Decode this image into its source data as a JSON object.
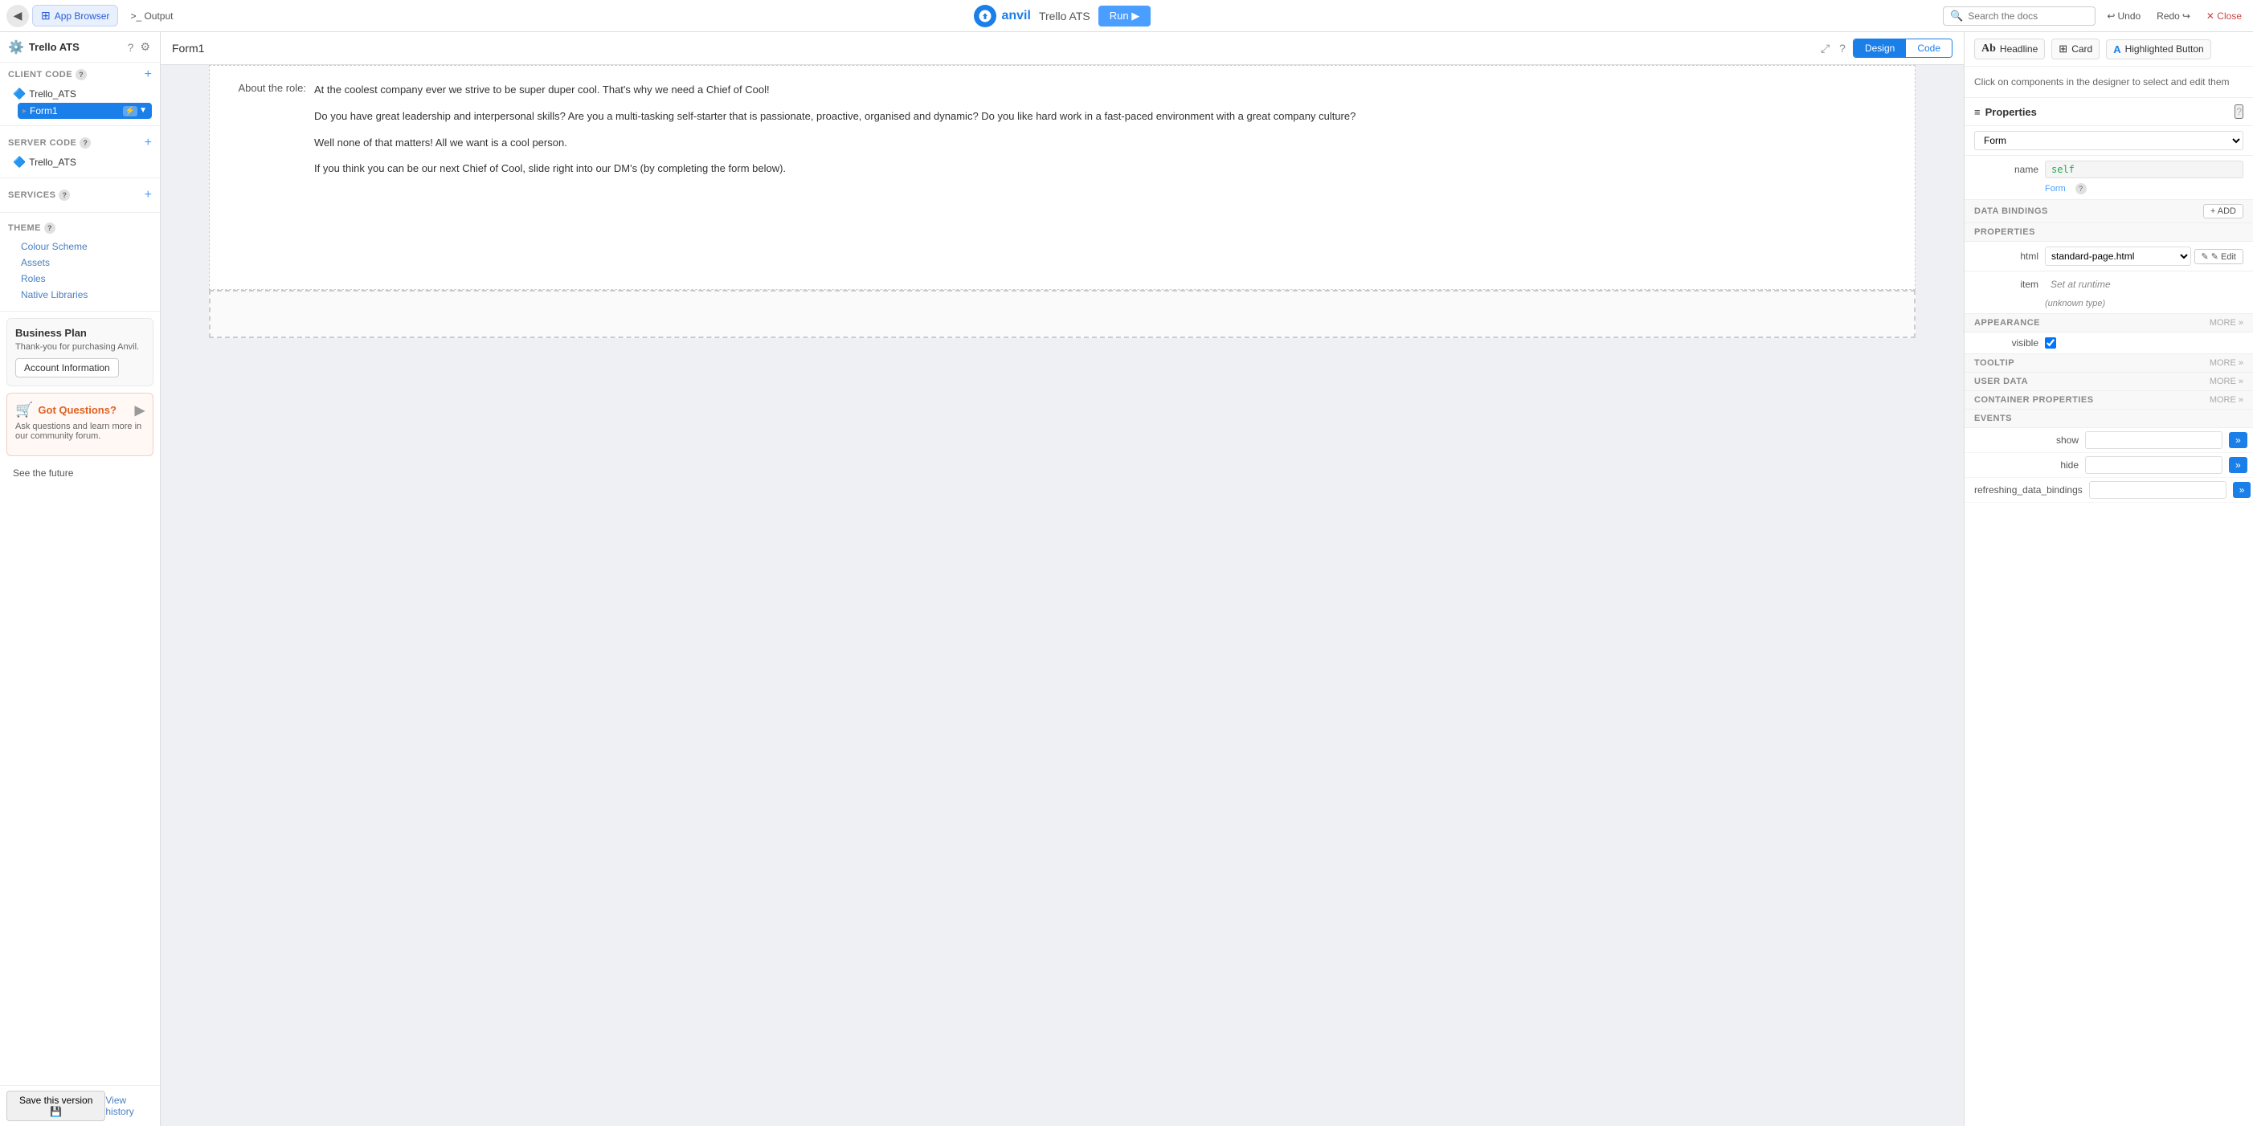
{
  "topbar": {
    "app_browser_label": "App Browser",
    "output_label": ">_ Output",
    "app_name": "Trello ATS",
    "run_label": "Run ▶",
    "search_placeholder": "Search the docs",
    "undo_label": "Undo",
    "redo_label": "Redo",
    "close_label": "✕ Close",
    "anvil_label": "anvil"
  },
  "sidebar": {
    "title": "Trello ATS",
    "client_code_label": "CLIENT CODE",
    "trello_ats_label": "Trello_ATS",
    "form1_label": "Form1",
    "server_code_label": "SERVER CODE",
    "server_trello_ats_label": "Trello_ATS",
    "services_label": "SERVICES",
    "theme_label": "THEME",
    "colour_scheme_label": "Colour Scheme",
    "assets_label": "Assets",
    "roles_label": "Roles",
    "native_libraries_label": "Native Libraries",
    "business_plan_title": "Business Plan",
    "business_plan_desc": "Thank-you for purchasing Anvil.",
    "account_info_btn": "Account Information",
    "got_questions_title": "Got Questions?",
    "got_questions_desc": "Ask questions and learn more in our community forum.",
    "see_future_label": "See the future",
    "save_version_label": "Save this version 💾",
    "view_history_label": "View history"
  },
  "form": {
    "title": "Form1",
    "design_tab": "Design",
    "code_tab": "Code",
    "role_label": "About the role:",
    "paragraph1": "At the coolest company ever we strive to be super duper cool. That's why we need a Chief of Cool!",
    "paragraph2": "Do you have great leadership and interpersonal skills? Are you a multi-tasking self-starter that is passionate, proactive, organised and dynamic? Do you like hard work in a fast-paced environment with a great company culture?",
    "paragraph3": "Well none of that matters! All we want is a cool person.",
    "paragraph4": "If you think you can be our next Chief of Cool, slide right into our DM's (by completing the form below)."
  },
  "component_bar": {
    "ab_label": "Ab",
    "headline_label": "Headline",
    "card_label": "Card",
    "highlighted_button_label": "Highlighted Button"
  },
  "properties": {
    "title": "Properties",
    "hint_text": "Click on components in the designer to select and edit them",
    "form_type": "Form",
    "name_label": "name",
    "name_value": "self",
    "form_link_label": "Form",
    "html_label": "html",
    "html_value": "standard-page.html",
    "edit_label": "✎ Edit",
    "item_label": "item",
    "item_hint1": "Set at runtime",
    "item_hint2": "(unknown type)",
    "data_bindings_label": "DATA BINDINGS",
    "add_label": "+ ADD",
    "properties_label": "PROPERTIES",
    "appearance_label": "APPEARANCE",
    "more_label": "MORE »",
    "visible_label": "visible",
    "tooltip_label": "TOOLTIP",
    "user_data_label": "USER DATA",
    "container_properties_label": "CONTAINER PROPERTIES",
    "events_label": "EVENTS",
    "show_label": "show",
    "hide_label": "hide",
    "refreshing_label": "refreshing_data_bindings"
  }
}
